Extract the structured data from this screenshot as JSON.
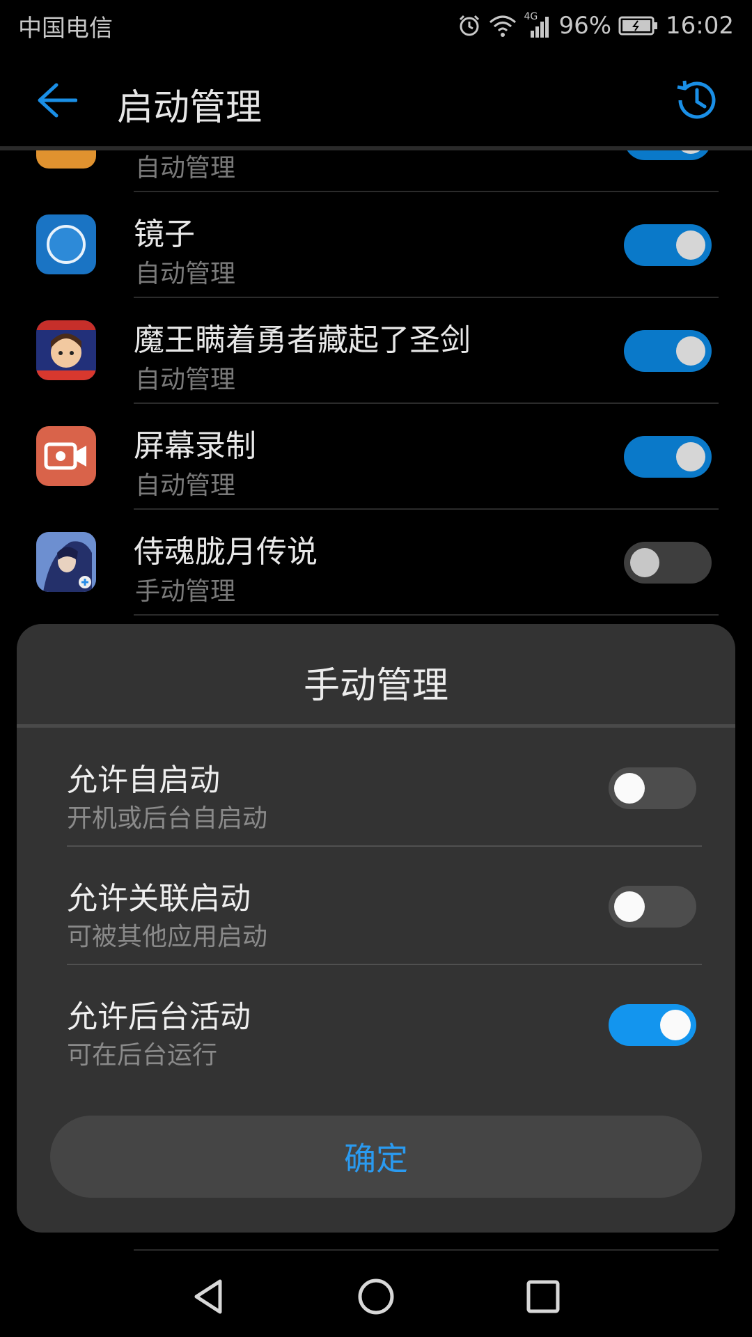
{
  "status_bar": {
    "carrier": "中国电信",
    "network": "4G",
    "battery": "96%",
    "time": "16:02"
  },
  "toolbar": {
    "title": "启动管理"
  },
  "apps": [
    {
      "name": "",
      "subtitle": "自动管理",
      "enabled": true,
      "icon": "orange-app-icon"
    },
    {
      "name": "镜子",
      "subtitle": "自动管理",
      "enabled": true,
      "icon": "mirror-app-icon"
    },
    {
      "name": "魔王瞒着勇者藏起了圣剑",
      "subtitle": "自动管理",
      "enabled": true,
      "icon": "game-app-icon"
    },
    {
      "name": "屏幕录制",
      "subtitle": "自动管理",
      "enabled": true,
      "icon": "screen-record-app-icon"
    },
    {
      "name": "侍魂胧月传说",
      "subtitle": "手动管理",
      "enabled": false,
      "icon": "samurai-game-app-icon"
    }
  ],
  "dialog": {
    "title": "手动管理",
    "options": [
      {
        "label": "允许自启动",
        "sub": "开机或后台自启动",
        "enabled": false
      },
      {
        "label": "允许关联启动",
        "sub": "可被其他应用启动",
        "enabled": false
      },
      {
        "label": "允许后台活动",
        "sub": "可在后台运行",
        "enabled": true
      }
    ],
    "confirm_label": "确定"
  },
  "colors": {
    "accent": "#1395ee",
    "switch_on": "#0a79c9",
    "dialog_bg": "#333333",
    "background": "#000000"
  }
}
